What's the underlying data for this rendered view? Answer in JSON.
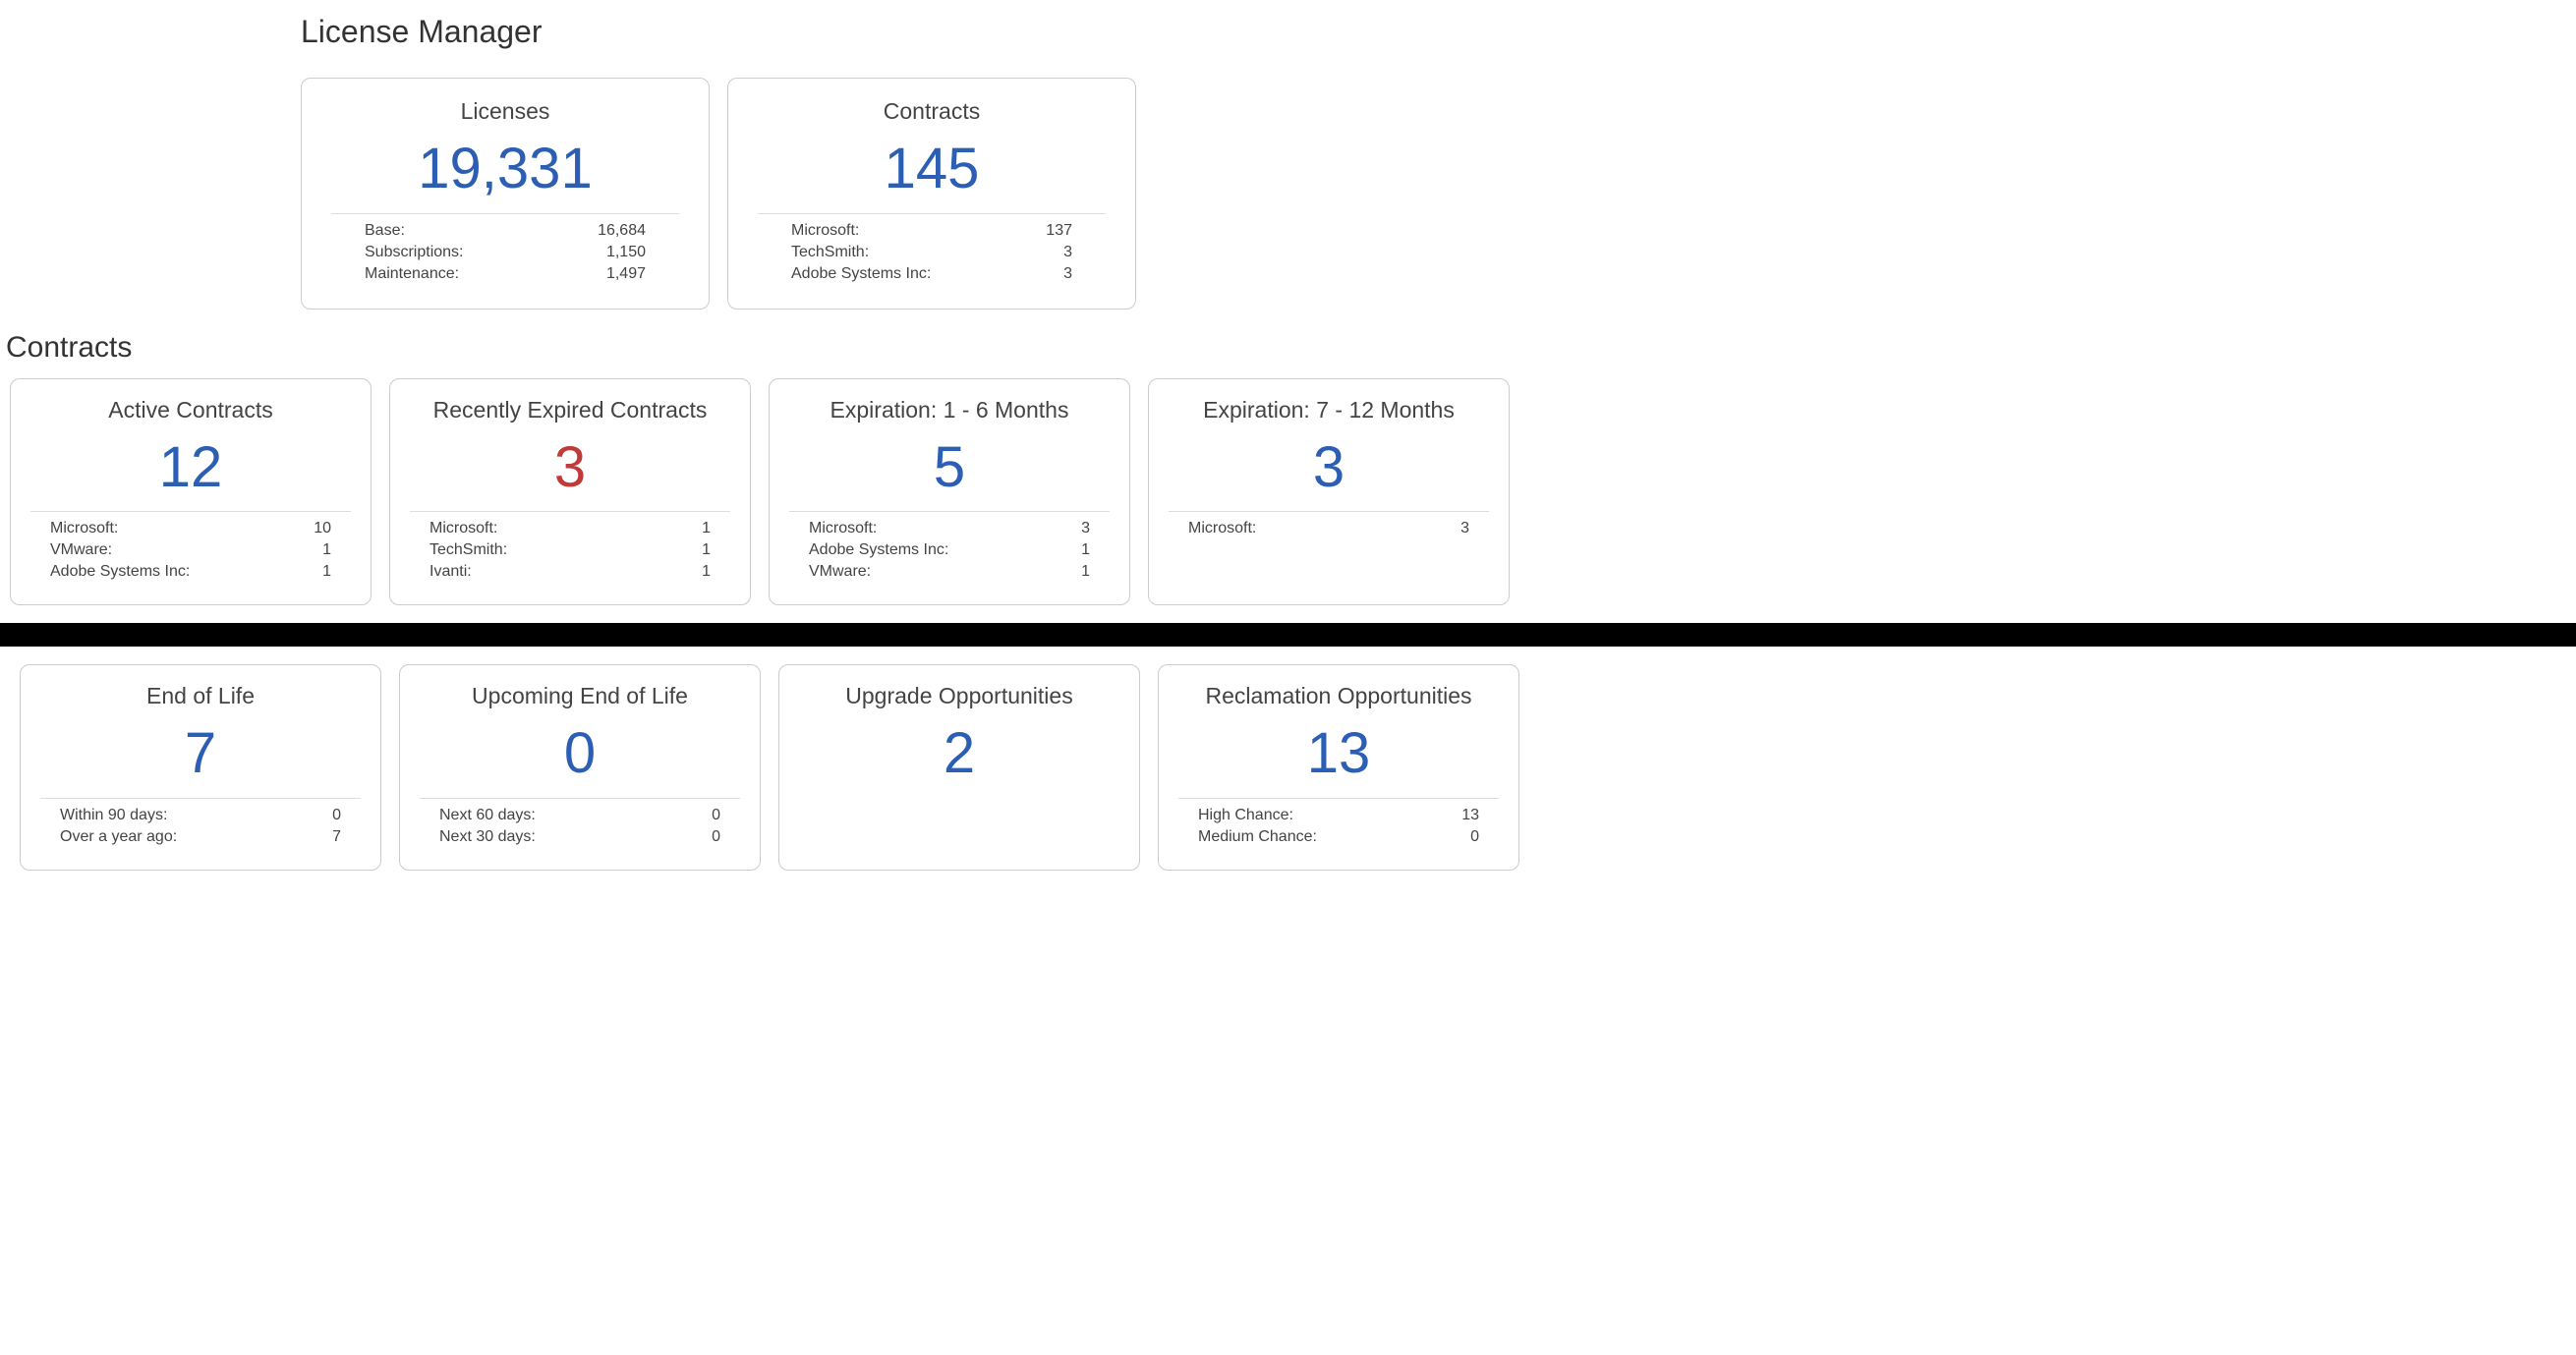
{
  "page_title": "License Manager",
  "top_cards": {
    "licenses": {
      "title": "Licenses",
      "value": "19,331",
      "rows": [
        {
          "label": "Base:",
          "value": "16,684"
        },
        {
          "label": "Subscriptions:",
          "value": "1,150"
        },
        {
          "label": "Maintenance:",
          "value": "1,497"
        }
      ]
    },
    "contracts": {
      "title": "Contracts",
      "value": "145",
      "rows": [
        {
          "label": "Microsoft:",
          "value": "137"
        },
        {
          "label": "TechSmith:",
          "value": "3"
        },
        {
          "label": "Adobe Systems Inc:",
          "value": "3"
        }
      ]
    }
  },
  "contracts_section_label": "Contracts",
  "contract_cards": [
    {
      "title": "Active Contracts",
      "value": "12",
      "color": "blue",
      "rows": [
        {
          "label": "Microsoft:",
          "value": "10"
        },
        {
          "label": "VMware:",
          "value": "1"
        },
        {
          "label": "Adobe Systems Inc:",
          "value": "1"
        }
      ]
    },
    {
      "title": "Recently Expired Contracts",
      "value": "3",
      "color": "red",
      "rows": [
        {
          "label": "Microsoft:",
          "value": "1"
        },
        {
          "label": "TechSmith:",
          "value": "1"
        },
        {
          "label": "Ivanti:",
          "value": "1"
        }
      ]
    },
    {
      "title": "Expiration: 1 - 6 Months",
      "value": "5",
      "color": "blue",
      "rows": [
        {
          "label": "Microsoft:",
          "value": "3"
        },
        {
          "label": "Adobe Systems Inc:",
          "value": "1"
        },
        {
          "label": "VMware:",
          "value": "1"
        }
      ]
    },
    {
      "title": "Expiration: 7 - 12 Months",
      "value": "3",
      "color": "blue",
      "rows": [
        {
          "label": "Microsoft:",
          "value": "3"
        }
      ]
    }
  ],
  "bottom_cards": [
    {
      "title": "End of Life",
      "value": "7",
      "rows": [
        {
          "label": "Within 90 days:",
          "value": "0"
        },
        {
          "label": "Over a year ago:",
          "value": "7"
        }
      ]
    },
    {
      "title": "Upcoming End of Life",
      "value": "0",
      "rows": [
        {
          "label": "Next 60 days:",
          "value": "0"
        },
        {
          "label": "Next 30 days:",
          "value": "0"
        }
      ]
    },
    {
      "title": "Upgrade Opportunities",
      "value": "2",
      "rows": []
    },
    {
      "title": "Reclamation Opportunities",
      "value": "13",
      "rows": [
        {
          "label": "High Chance:",
          "value": "13"
        },
        {
          "label": "Medium Chance:",
          "value": "0"
        }
      ]
    }
  ]
}
